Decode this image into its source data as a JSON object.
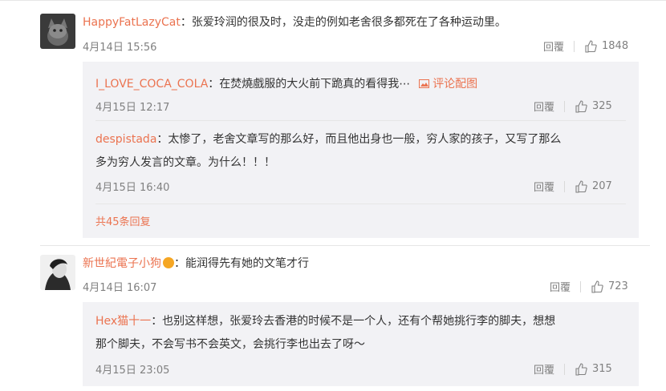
{
  "comments": [
    {
      "user": "HappyFatLazyCat",
      "text": "：张爱玲润的很及时，没走的例如老舍很多都死在了各种运动里。",
      "time": "4月14日 15:56",
      "reply_label": "回覆",
      "likes": "1848",
      "replies": [
        {
          "user": "I_LOVE_COCA_COLA",
          "text": "：在焚燒戲服的大火前下跪真的看得我⋯",
          "pic_link": "评论配图",
          "time": "4月15日 12:17",
          "reply_label": "回覆",
          "likes": "325"
        },
        {
          "user": "despistada",
          "text_line1": "：太惨了，老舍文章写的那么好，而且他出身也一般，穷人家的孩子，又写了那么",
          "text_line2": "多为穷人发言的文章。为什么！！！",
          "time": "4月15日 16:40",
          "reply_label": "回覆",
          "likes": "207"
        }
      ],
      "more_replies": "共45条回复"
    },
    {
      "user": "新世紀電子小狗",
      "text": "：能润得先有她的文笔才行",
      "time": "4月14日 16:07",
      "reply_label": "回覆",
      "likes": "723",
      "replies": [
        {
          "user": "Hex猫十一",
          "text_line1": "：也别这样想，张爱玲去香港的时候不是一个人，还有个帮她挑行李的脚夫，想想",
          "text_line2": "那个脚夫，不会写书不会英文，会挑行李也出去了呀～",
          "time": "4月15日 23:05",
          "reply_label": "回覆",
          "likes": "315"
        }
      ]
    }
  ],
  "colors": {
    "username": "#eb7350",
    "reply_bg": "#f2f2f5",
    "meta": "#808080"
  }
}
